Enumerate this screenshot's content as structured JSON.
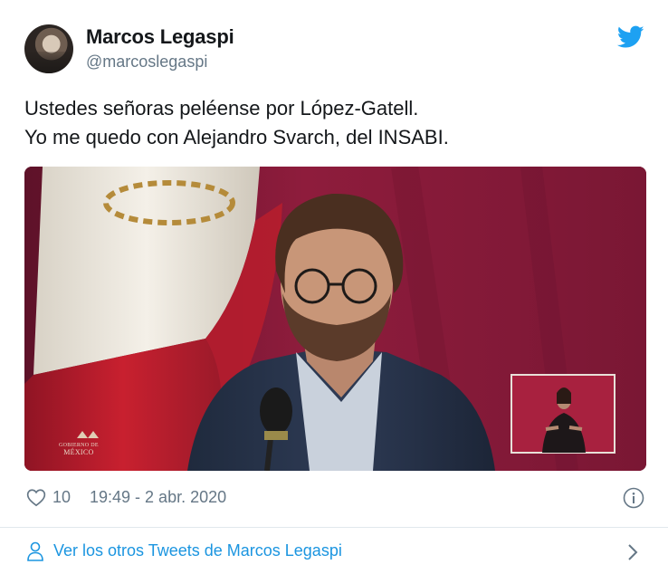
{
  "author": {
    "name": "Marcos Legaspi",
    "handle": "@marcoslegaspi"
  },
  "tweet": {
    "lines": [
      "Ustedes señoras peléense por López-Gatell.",
      "Yo me quedo con Alejandro Svarch, del INSABI."
    ]
  },
  "media": {
    "logo_line1": "GOBIERNO DE",
    "logo_line2": "MÉXICO"
  },
  "meta": {
    "likes": "10",
    "timestamp": "19:49 - 2 abr. 2020"
  },
  "footer": {
    "more_tweets_label": "Ver los otros Tweets de Marcos Legaspi"
  },
  "colors": {
    "twitter_blue": "#1da1f2",
    "link_blue": "#1b95e0",
    "muted_gray": "#657786",
    "background_maroon": "#8c1b3a"
  },
  "icons": [
    "twitter-bird-icon",
    "heart-icon",
    "info-icon",
    "person-icon",
    "chevron-right-icon"
  ]
}
